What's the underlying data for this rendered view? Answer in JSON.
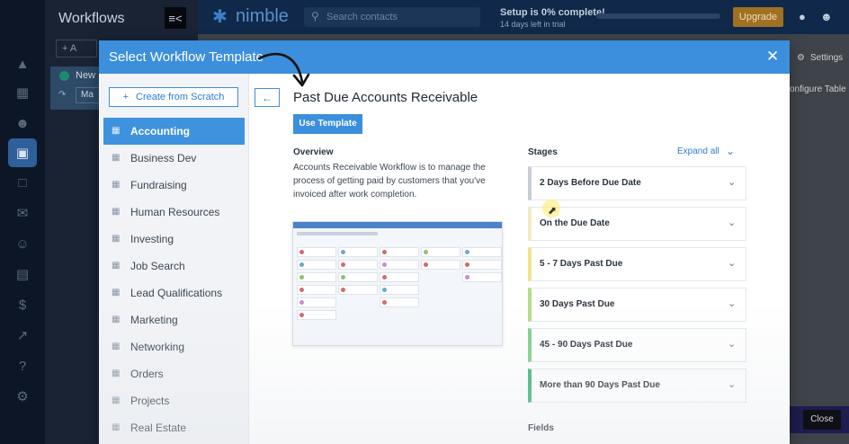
{
  "app": {
    "panel_title": "Workflows",
    "add_label": "+ A",
    "workflow_item_name": "New",
    "workflow_item_sub": "Ma",
    "logo_text": "nimble",
    "search_placeholder": "Search contacts",
    "setup_title": "Setup is 0% complete!",
    "setup_sub": "14 days left in trial",
    "setup_progress": 0,
    "upgrade_label": "Upgrade",
    "settings_label": "Settings",
    "configure_label": "onfigure Table",
    "close_label": "Close"
  },
  "modal": {
    "title": "Select Workflow Template",
    "create_scratch_label": "Create from Scratch",
    "categories": [
      {
        "label": "Accounting",
        "active": true
      },
      {
        "label": "Business Dev",
        "active": false
      },
      {
        "label": "Fundraising",
        "active": false
      },
      {
        "label": "Human Resources",
        "active": false
      },
      {
        "label": "Investing",
        "active": false
      },
      {
        "label": "Job Search",
        "active": false
      },
      {
        "label": "Lead Qualifications",
        "active": false
      },
      {
        "label": "Marketing",
        "active": false
      },
      {
        "label": "Networking",
        "active": false
      },
      {
        "label": "Orders",
        "active": false
      },
      {
        "label": "Projects",
        "active": false
      },
      {
        "label": "Real Estate",
        "active": false
      }
    ],
    "template_title": "Past Due Accounts Receivable",
    "use_template_label": "Use Template",
    "overview_label": "Overview",
    "overview_text": "Accounts Receivable Workflow is to manage the process of getting paid by customers that you've invoiced after work completion.",
    "stages_label": "Stages",
    "expand_all_label": "Expand all",
    "stages": [
      {
        "label": "2 Days Before Due Date",
        "color": "#c9ced5"
      },
      {
        "label": "On the Due Date",
        "color": "#f3ecc2"
      },
      {
        "label": "5 - 7 Days Past Due",
        "color": "#efe48a"
      },
      {
        "label": "30 Days Past Due",
        "color": "#b7dc88"
      },
      {
        "label": "45 - 90 Days Past Due",
        "color": "#7fcf8a"
      },
      {
        "label": "More than 90 Days Past Due",
        "color": "#3fb57a"
      }
    ],
    "fields_label": "Fields"
  },
  "colors": {
    "accent": "#3c8fdc",
    "header": "#3c8fdc",
    "upgrade": "#a07122"
  }
}
